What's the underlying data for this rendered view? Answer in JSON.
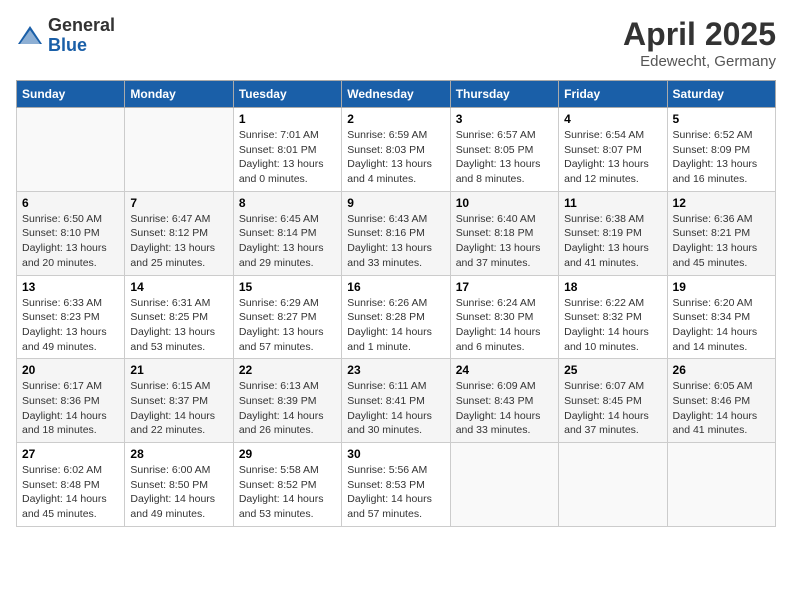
{
  "logo": {
    "general": "General",
    "blue": "Blue"
  },
  "title": "April 2025",
  "location": "Edewecht, Germany",
  "days_of_week": [
    "Sunday",
    "Monday",
    "Tuesday",
    "Wednesday",
    "Thursday",
    "Friday",
    "Saturday"
  ],
  "weeks": [
    [
      {
        "day": null,
        "info": null
      },
      {
        "day": null,
        "info": null
      },
      {
        "day": "1",
        "info": "Sunrise: 7:01 AM\nSunset: 8:01 PM\nDaylight: 13 hours and 0 minutes."
      },
      {
        "day": "2",
        "info": "Sunrise: 6:59 AM\nSunset: 8:03 PM\nDaylight: 13 hours and 4 minutes."
      },
      {
        "day": "3",
        "info": "Sunrise: 6:57 AM\nSunset: 8:05 PM\nDaylight: 13 hours and 8 minutes."
      },
      {
        "day": "4",
        "info": "Sunrise: 6:54 AM\nSunset: 8:07 PM\nDaylight: 13 hours and 12 minutes."
      },
      {
        "day": "5",
        "info": "Sunrise: 6:52 AM\nSunset: 8:09 PM\nDaylight: 13 hours and 16 minutes."
      }
    ],
    [
      {
        "day": "6",
        "info": "Sunrise: 6:50 AM\nSunset: 8:10 PM\nDaylight: 13 hours and 20 minutes."
      },
      {
        "day": "7",
        "info": "Sunrise: 6:47 AM\nSunset: 8:12 PM\nDaylight: 13 hours and 25 minutes."
      },
      {
        "day": "8",
        "info": "Sunrise: 6:45 AM\nSunset: 8:14 PM\nDaylight: 13 hours and 29 minutes."
      },
      {
        "day": "9",
        "info": "Sunrise: 6:43 AM\nSunset: 8:16 PM\nDaylight: 13 hours and 33 minutes."
      },
      {
        "day": "10",
        "info": "Sunrise: 6:40 AM\nSunset: 8:18 PM\nDaylight: 13 hours and 37 minutes."
      },
      {
        "day": "11",
        "info": "Sunrise: 6:38 AM\nSunset: 8:19 PM\nDaylight: 13 hours and 41 minutes."
      },
      {
        "day": "12",
        "info": "Sunrise: 6:36 AM\nSunset: 8:21 PM\nDaylight: 13 hours and 45 minutes."
      }
    ],
    [
      {
        "day": "13",
        "info": "Sunrise: 6:33 AM\nSunset: 8:23 PM\nDaylight: 13 hours and 49 minutes."
      },
      {
        "day": "14",
        "info": "Sunrise: 6:31 AM\nSunset: 8:25 PM\nDaylight: 13 hours and 53 minutes."
      },
      {
        "day": "15",
        "info": "Sunrise: 6:29 AM\nSunset: 8:27 PM\nDaylight: 13 hours and 57 minutes."
      },
      {
        "day": "16",
        "info": "Sunrise: 6:26 AM\nSunset: 8:28 PM\nDaylight: 14 hours and 1 minute."
      },
      {
        "day": "17",
        "info": "Sunrise: 6:24 AM\nSunset: 8:30 PM\nDaylight: 14 hours and 6 minutes."
      },
      {
        "day": "18",
        "info": "Sunrise: 6:22 AM\nSunset: 8:32 PM\nDaylight: 14 hours and 10 minutes."
      },
      {
        "day": "19",
        "info": "Sunrise: 6:20 AM\nSunset: 8:34 PM\nDaylight: 14 hours and 14 minutes."
      }
    ],
    [
      {
        "day": "20",
        "info": "Sunrise: 6:17 AM\nSunset: 8:36 PM\nDaylight: 14 hours and 18 minutes."
      },
      {
        "day": "21",
        "info": "Sunrise: 6:15 AM\nSunset: 8:37 PM\nDaylight: 14 hours and 22 minutes."
      },
      {
        "day": "22",
        "info": "Sunrise: 6:13 AM\nSunset: 8:39 PM\nDaylight: 14 hours and 26 minutes."
      },
      {
        "day": "23",
        "info": "Sunrise: 6:11 AM\nSunset: 8:41 PM\nDaylight: 14 hours and 30 minutes."
      },
      {
        "day": "24",
        "info": "Sunrise: 6:09 AM\nSunset: 8:43 PM\nDaylight: 14 hours and 33 minutes."
      },
      {
        "day": "25",
        "info": "Sunrise: 6:07 AM\nSunset: 8:45 PM\nDaylight: 14 hours and 37 minutes."
      },
      {
        "day": "26",
        "info": "Sunrise: 6:05 AM\nSunset: 8:46 PM\nDaylight: 14 hours and 41 minutes."
      }
    ],
    [
      {
        "day": "27",
        "info": "Sunrise: 6:02 AM\nSunset: 8:48 PM\nDaylight: 14 hours and 45 minutes."
      },
      {
        "day": "28",
        "info": "Sunrise: 6:00 AM\nSunset: 8:50 PM\nDaylight: 14 hours and 49 minutes."
      },
      {
        "day": "29",
        "info": "Sunrise: 5:58 AM\nSunset: 8:52 PM\nDaylight: 14 hours and 53 minutes."
      },
      {
        "day": "30",
        "info": "Sunrise: 5:56 AM\nSunset: 8:53 PM\nDaylight: 14 hours and 57 minutes."
      },
      {
        "day": null,
        "info": null
      },
      {
        "day": null,
        "info": null
      },
      {
        "day": null,
        "info": null
      }
    ]
  ]
}
